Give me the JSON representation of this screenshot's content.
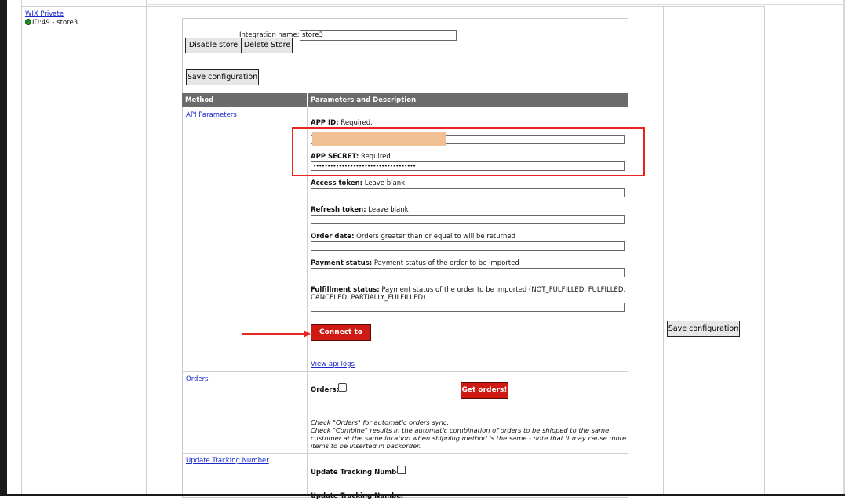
{
  "store": {
    "name": "WIX Private",
    "id_text": "ID:49 - store3",
    "status_color": "#1e8c1e"
  },
  "integration": {
    "name_label": "Integration name:",
    "name_value": "store3"
  },
  "buttons": {
    "disable_store": "Disable store",
    "delete_store": "Delete Store",
    "save_configuration": "Save configuration",
    "save_configuration_right": "Save configuration",
    "connect": "Connect to WIX",
    "get_orders": "Get orders!"
  },
  "table": {
    "headers": [
      "Method",
      "Parameters and Description"
    ],
    "header_color": "#6b6b6b"
  },
  "methods": {
    "api_parameters": "API Parameters",
    "orders": "Orders",
    "update_tracking": "Update Tracking Number"
  },
  "params": {
    "app_id": {
      "label": "APP ID:",
      "desc": "Required.",
      "value": ""
    },
    "app_secret": {
      "label": "APP SECRET:",
      "desc": "Required.",
      "value": "••••••••••••••••••••••••••••••••••••"
    },
    "access_token": {
      "label": "Access token:",
      "desc": "Leave blank",
      "value": ""
    },
    "refresh_token": {
      "label": "Refresh token:",
      "desc": "Leave blank",
      "value": ""
    },
    "order_date": {
      "label": "Order date:",
      "desc": "Orders greater than or equal to will be returned",
      "value": ""
    },
    "payment_status": {
      "label": "Payment status:",
      "desc": "Payment status of the order to be imported",
      "value": ""
    },
    "fulfillment_status": {
      "label": "Fulfillment status:",
      "desc": "Payment status of the order to be imported (NOT_FULFILLED, FULFILLED,",
      "desc2": "CANCELED, PARTIALLY_FULFILLED)",
      "value": ""
    }
  },
  "links": {
    "view_api_logs": "View api logs"
  },
  "orders": {
    "checkbox_label": "Orders:",
    "note1": "Check \"Orders\" for automatic orders sync.",
    "note2": "Check \"Combine\" results in the automatic combination of orders to be shipped to the same",
    "note3": "customer at the same location when shipping method is the same - note that it may cause more",
    "note4": "items to be inserted in backorder."
  },
  "tracking": {
    "checkbox_label": "Update Tracking Number:",
    "partial_text": "Update Tracking Number"
  },
  "annotations": {
    "highlight_color": "#e8261f",
    "redaction_color": "#f2c095"
  }
}
